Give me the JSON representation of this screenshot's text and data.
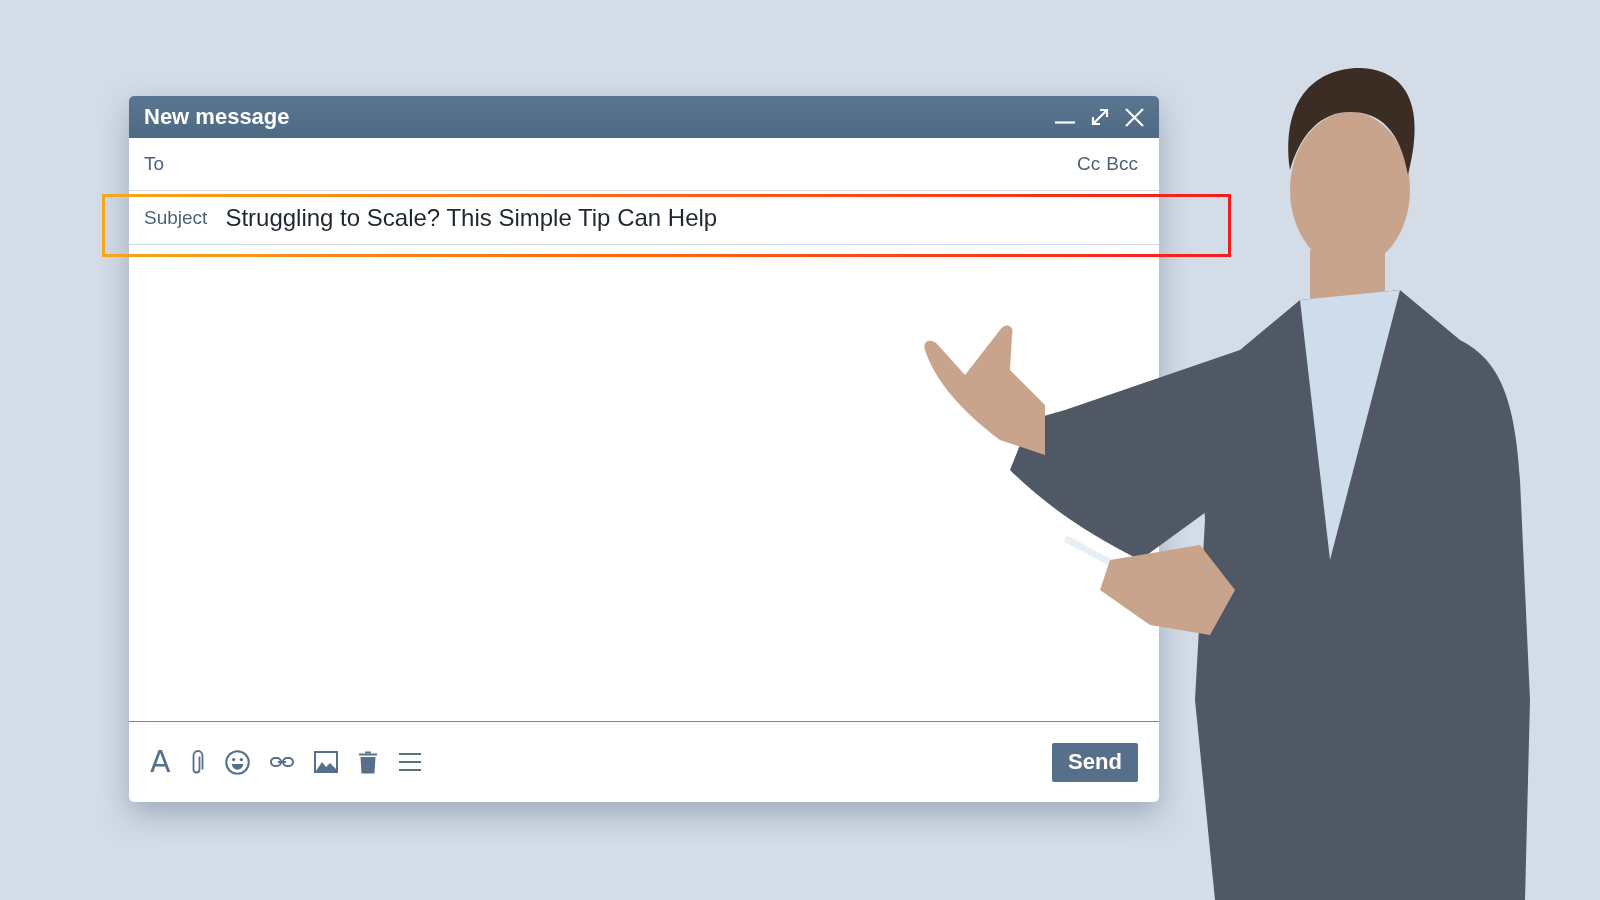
{
  "window": {
    "title": "New message"
  },
  "to": {
    "label": "To",
    "cc": "Cc",
    "bcc": "Bcc"
  },
  "subject": {
    "label": "Subject",
    "value": "Struggling to Scale? This Simple Tip Can Help",
    "highlighted": true
  },
  "toolbar": {
    "format_glyph": "A",
    "send": "Send"
  }
}
